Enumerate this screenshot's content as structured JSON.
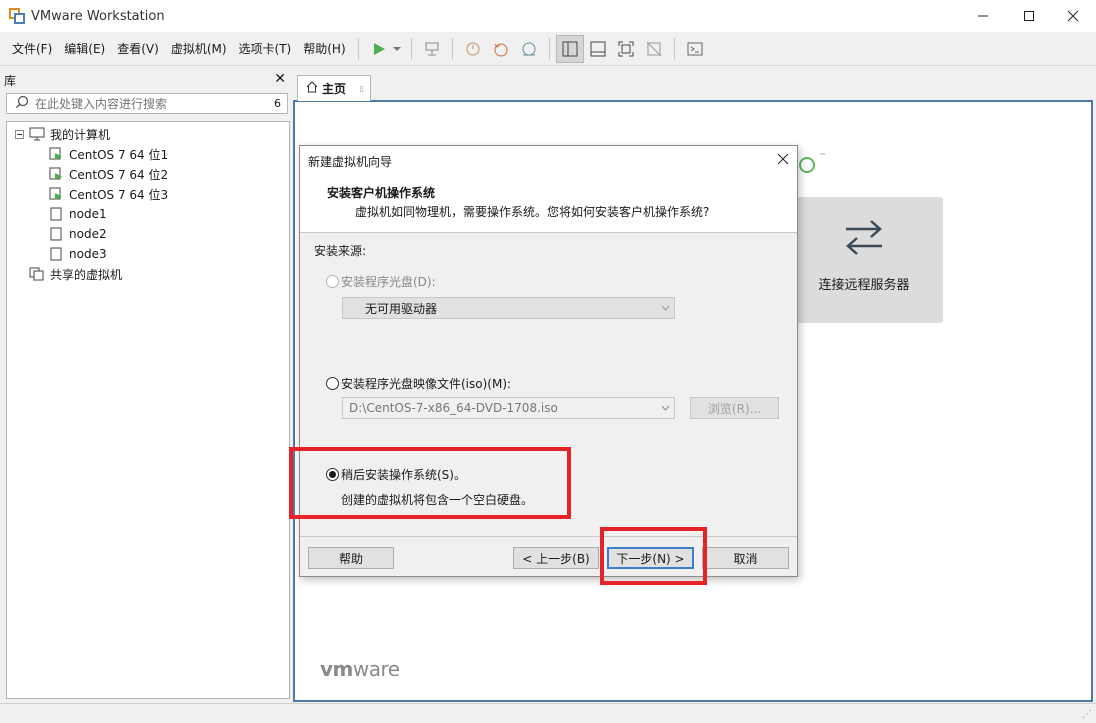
{
  "window": {
    "title": "VMware Workstation"
  },
  "menu": [
    "文件(F)",
    "编辑(E)",
    "查看(V)",
    "虚拟机(M)",
    "选项卡(T)",
    "帮助(H)"
  ],
  "library": {
    "title": "库",
    "search_placeholder": "在此处键入内容进行搜索",
    "search_count": "6",
    "tree": {
      "root": "我的计算机",
      "vms": [
        "CentOS 7 64 位1",
        "CentOS 7 64 位2",
        "CentOS 7 64 位3",
        "node1",
        "node2",
        "node3"
      ],
      "shared": "共享的虚拟机"
    }
  },
  "tab": {
    "label": "主页"
  },
  "home": {
    "remote_label": "连接远程服务器",
    "logo_tm": "™",
    "vmware_logo_a": "vm",
    "vmware_logo_b": "ware"
  },
  "dialog": {
    "title": "新建虚拟机向导",
    "heading": "安装客户机操作系统",
    "subheading": "虚拟机如同物理机，需要操作系统。您将如何安装客户机操作系统?",
    "source_label": "安装来源:",
    "option_disc": "安装程序光盘(D):",
    "drive_value": "无可用驱动器",
    "option_iso": "安装程序光盘映像文件(iso)(M):",
    "iso_value": "D:\\CentOS-7-x86_64-DVD-1708.iso",
    "browse": "浏览(R)...",
    "option_later": "稍后安装操作系统(S)。",
    "later_desc": "创建的虚拟机将包含一个空白硬盘。",
    "help": "帮助",
    "back": "< 上一步(B)",
    "next": "下一步(N) >",
    "cancel": "取消",
    "selected_option": "later"
  },
  "colors": {
    "highlight": "#e52329",
    "content_border": "#4d7aa8",
    "play": "#4caf50"
  }
}
